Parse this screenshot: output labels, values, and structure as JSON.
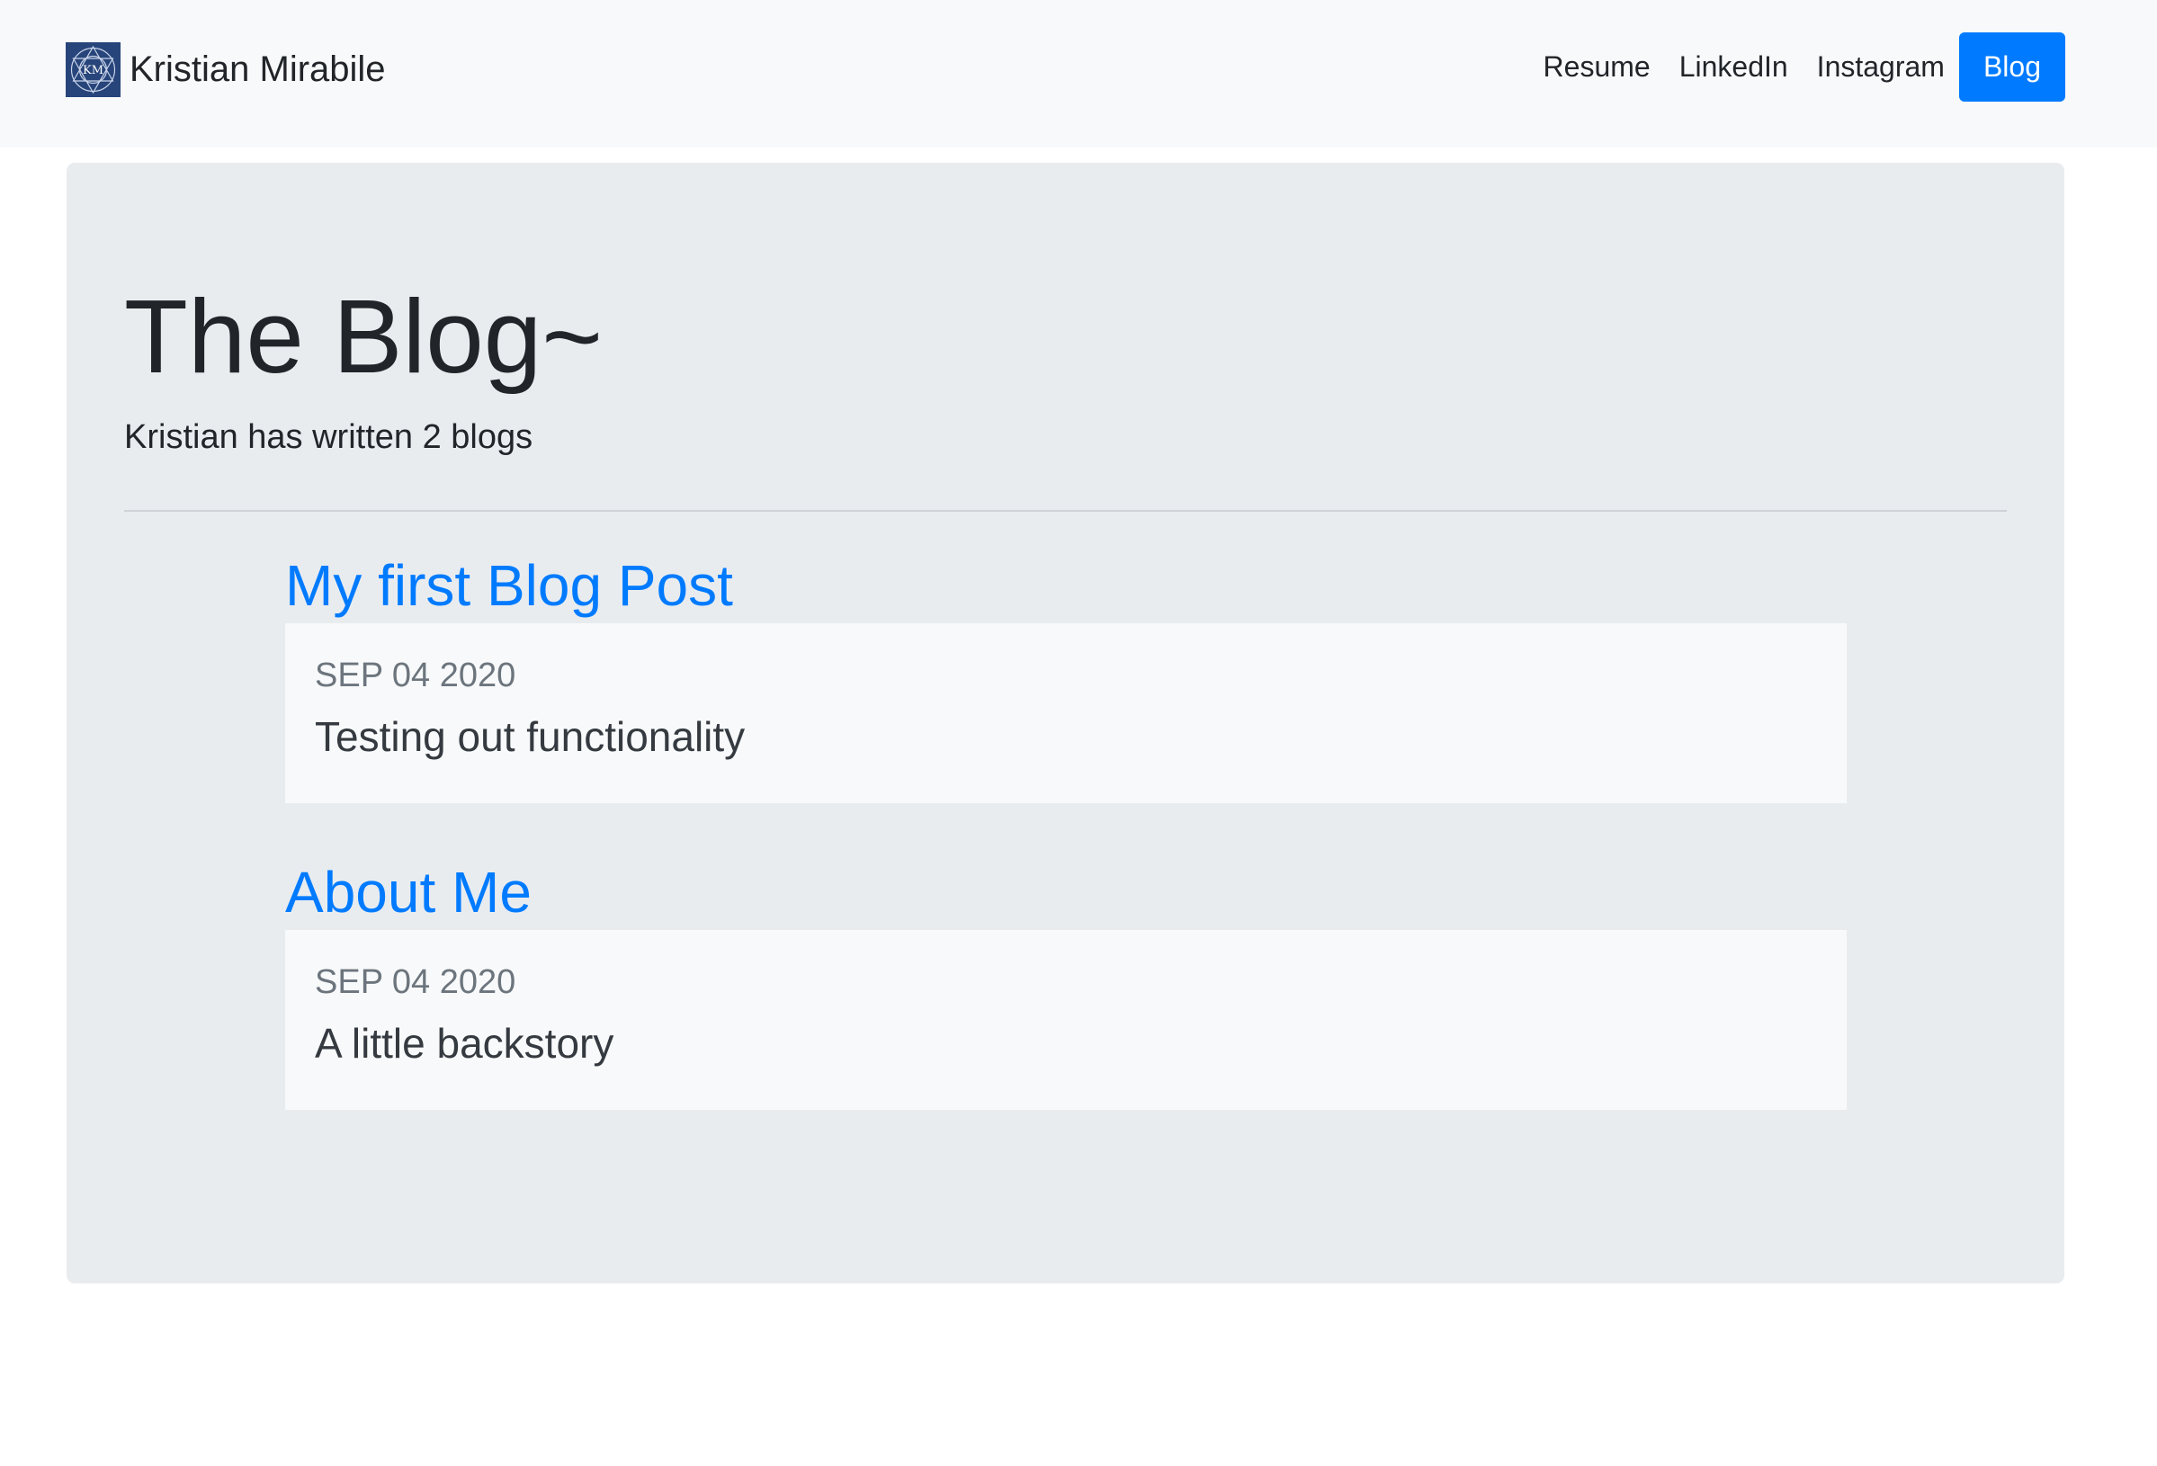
{
  "navbar": {
    "brand_initials": "KM",
    "brand_name": "Kristian Mirabile",
    "links": [
      {
        "label": "Resume"
      },
      {
        "label": "LinkedIn"
      },
      {
        "label": "Instagram"
      },
      {
        "label": "Blog",
        "active": true
      }
    ],
    "active_color": "#007bff"
  },
  "main": {
    "title": "The Blog~",
    "lead": "Kristian has written 2 blogs",
    "posts": [
      {
        "title": "My first Blog Post",
        "date": "SEP 04 2020",
        "summary": "Testing out functionality"
      },
      {
        "title": "About Me",
        "date": "SEP 04 2020",
        "summary": "A little backstory"
      }
    ]
  },
  "colors": {
    "link": "#007bff",
    "jumbotron_bg": "#e9ecef",
    "card_bg": "#f8f9fa",
    "navbar_bg": "#f8f9fa",
    "logo_bg": "#27457a"
  }
}
